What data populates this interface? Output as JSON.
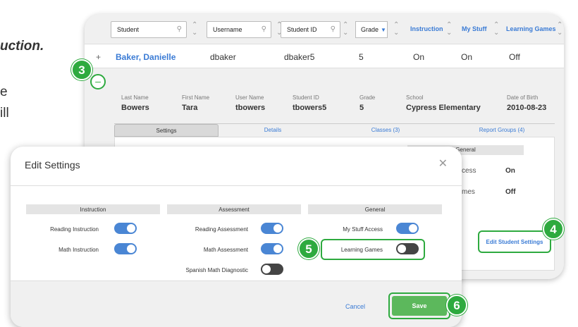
{
  "background_text": [
    "uction.",
    "e",
    "ill"
  ],
  "filters": {
    "student_placeholder": "Student",
    "username_placeholder": "Username",
    "studentid_placeholder": "Student ID",
    "grade_label": "Grade",
    "col_instruction": "Instruction",
    "col_mystuff": "My Stuff",
    "col_learninggames": "Learning Games"
  },
  "student_row": {
    "expand": "+",
    "name": "Baker, Danielle",
    "username": "dbaker",
    "student_id": "dbaker5",
    "grade": "5",
    "instruction": "On",
    "mystuff": "On",
    "learninggames": "Off"
  },
  "detail": {
    "collapse": "–",
    "fields": [
      {
        "label": "Last Name",
        "value": "Bowers"
      },
      {
        "label": "First Name",
        "value": "Tara"
      },
      {
        "label": "User Name",
        "value": "tbowers"
      },
      {
        "label": "Student ID",
        "value": "tbowers5"
      },
      {
        "label": "Grade",
        "value": "5"
      },
      {
        "label": "School",
        "value": "Cypress Elementary"
      },
      {
        "label": "Date of Birth",
        "value": "2010-08-23"
      }
    ],
    "tabs": [
      "Settings",
      "Details",
      "Classes (3)",
      "Report Groups (4)"
    ],
    "general_header": "General",
    "general_rows": [
      {
        "label": "cess",
        "value": "On"
      },
      {
        "label": "mes",
        "value": "Off"
      }
    ],
    "edit_button": "Edit Student Settings"
  },
  "badges": {
    "b3": "3",
    "b4": "4",
    "b5": "5",
    "b6": "6"
  },
  "modal": {
    "title": "Edit Settings",
    "close": "✕",
    "columns": [
      {
        "header": "Instruction",
        "items": [
          {
            "label": "Reading Instruction",
            "on": true
          },
          {
            "label": "Math Instruction",
            "on": true
          }
        ]
      },
      {
        "header": "Assessment",
        "items": [
          {
            "label": "Reading Assessment",
            "on": true
          },
          {
            "label": "Math Assessment",
            "on": true
          },
          {
            "label": "Spanish Math Diagnostic",
            "on": false
          }
        ]
      },
      {
        "header": "General",
        "items": [
          {
            "label": "My Stuff Access",
            "on": true
          },
          {
            "label": "Learning Games",
            "on": false
          }
        ]
      }
    ],
    "cancel_label": "Cancel",
    "save_label": "Save"
  },
  "colors": {
    "accent": "#3a7bd5",
    "highlight": "#2eaa3f",
    "save": "#5cb85c"
  }
}
